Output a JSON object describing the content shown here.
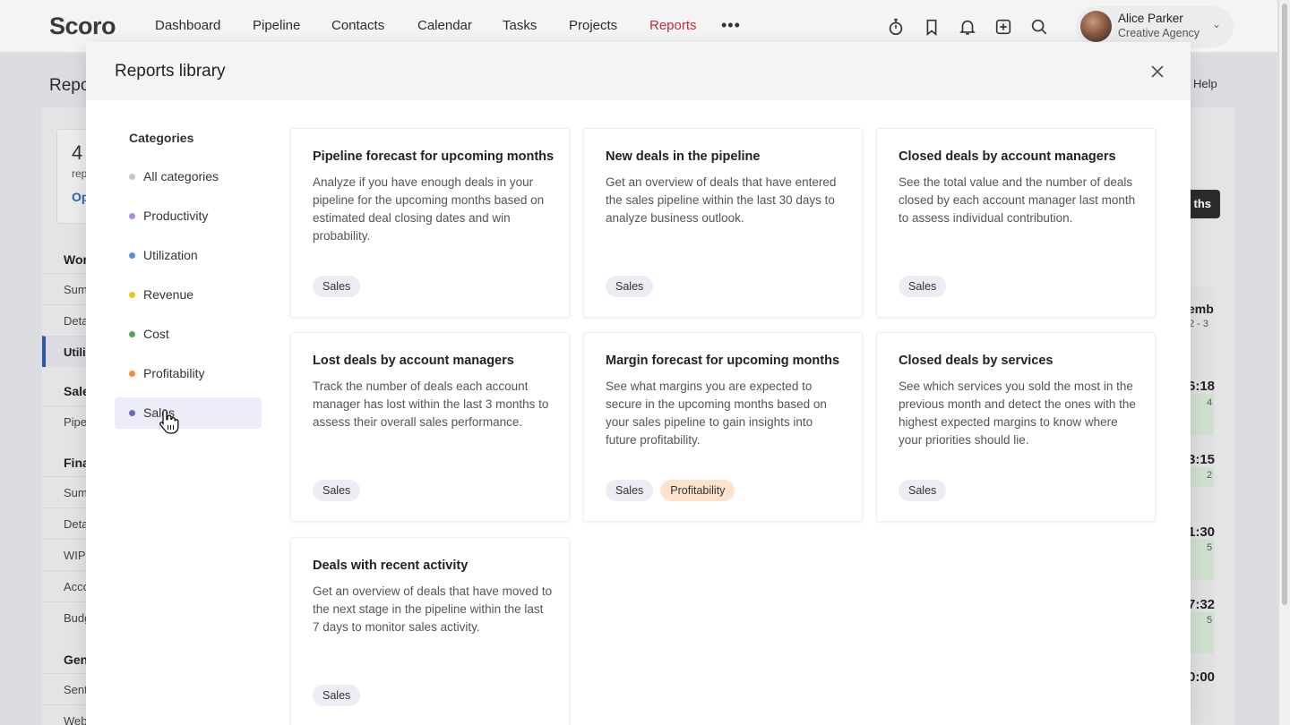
{
  "nav": {
    "logo": "Scoro",
    "items": [
      "Dashboard",
      "Pipeline",
      "Contacts",
      "Calendar",
      "Tasks",
      "Projects",
      "Reports"
    ],
    "active": "Reports",
    "more": "•••"
  },
  "user": {
    "name": "Alice Parker",
    "org": "Creative Agency"
  },
  "background": {
    "page_title": "Repo",
    "help": "Help",
    "card_number": "4",
    "card_sub": "rep",
    "card_link": "Op",
    "button_fragment": "ths",
    "sidebar": [
      {
        "type": "head",
        "label": "Wor"
      },
      {
        "type": "item",
        "label": "Sum"
      },
      {
        "type": "item",
        "label": "Deta"
      },
      {
        "type": "active",
        "label": "Utili"
      },
      {
        "type": "head",
        "label": "Sale"
      },
      {
        "type": "item",
        "label": "Pipe"
      },
      {
        "type": "head",
        "label": "Fina"
      },
      {
        "type": "item",
        "label": "Sum"
      },
      {
        "type": "item",
        "label": "Deta"
      },
      {
        "type": "item",
        "label": "WIP"
      },
      {
        "type": "item",
        "label": "Acco"
      },
      {
        "type": "item",
        "label": "Budg"
      },
      {
        "type": "head",
        "label": "Gen"
      },
      {
        "type": "item",
        "label": "Sent"
      },
      {
        "type": "item",
        "label": "Web"
      }
    ],
    "right_header": "emb",
    "right_range": "2 - 3",
    "right_times": [
      "6:18",
      "3:15",
      "1:30",
      "7:32",
      "0:00"
    ],
    "right_small": [
      "4",
      "2",
      "5",
      "5"
    ]
  },
  "modal": {
    "title": "Reports library",
    "close_label": "Close",
    "categories_heading": "Categories",
    "categories": [
      {
        "label": "All categories",
        "color": "#c5c5cb"
      },
      {
        "label": "Productivity",
        "color": "#a98bd8"
      },
      {
        "label": "Utilization",
        "color": "#5b8fd9"
      },
      {
        "label": "Revenue",
        "color": "#f0c419"
      },
      {
        "label": "Cost",
        "color": "#4fa55a"
      },
      {
        "label": "Profitability",
        "color": "#f0913a"
      },
      {
        "label": "Sales",
        "color": "#6a6ab8"
      }
    ],
    "selected_category": "Sales",
    "reports": [
      {
        "title": "Pipeline forecast for upcoming months",
        "desc": "Analyze if you have enough deals in your pipeline for the upcoming months based on estimated deal closing dates and win probability.",
        "tags": [
          "Sales"
        ]
      },
      {
        "title": "New deals in the pipeline",
        "desc": "Get an overview of deals that have entered the sales pipeline within the last 30 days to analyze business outlook.",
        "tags": [
          "Sales"
        ]
      },
      {
        "title": "Closed deals by account managers",
        "desc": "See the total value and the number of deals closed by each account manager last month to assess individual contribution.",
        "tags": [
          "Sales"
        ]
      },
      {
        "title": "Lost deals by account managers",
        "desc": "Track the number of deals each account manager has lost within the last 3 months to assess their overall sales performance.",
        "tags": [
          "Sales"
        ]
      },
      {
        "title": "Margin forecast for upcoming months",
        "desc": "See what margins you are expected to secure in the upcoming months based on your sales pipeline to gain insights into future profitability.",
        "tags": [
          "Sales",
          "Profitability"
        ]
      },
      {
        "title": "Closed deals by services",
        "desc": "See which services you sold the most in the previous month and detect the ones with the highest expected margins to know where your priorities should lie.",
        "tags": [
          "Sales"
        ]
      },
      {
        "title": "Deals with recent activity",
        "desc": "Get an overview of deals that have moved to the next stage in the pipeline within the last 7 days to monitor sales activity.",
        "tags": [
          "Sales"
        ]
      }
    ]
  }
}
